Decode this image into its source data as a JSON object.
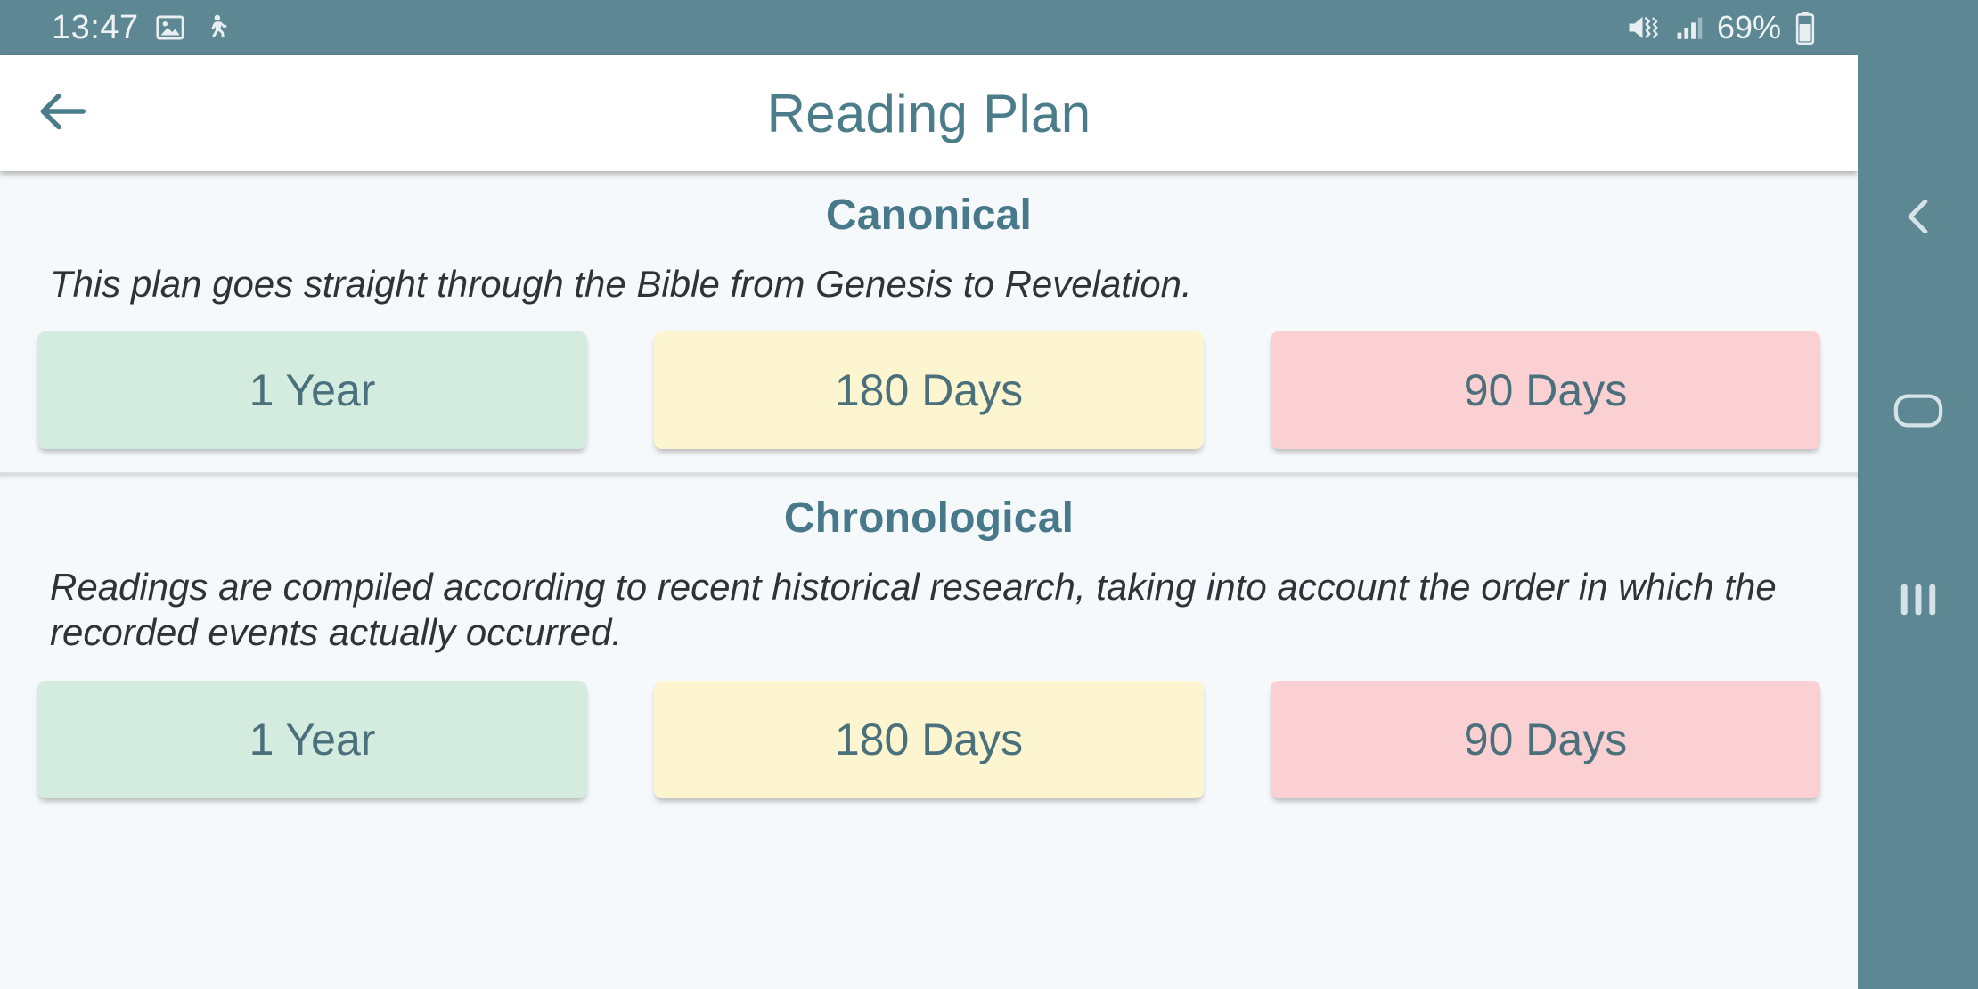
{
  "status_bar": {
    "clock": "13:47",
    "battery_percent": "69%",
    "icons": [
      "gallery-icon",
      "person-activity-icon",
      "volume-mute-vibrate-icon",
      "signal-bars-icon",
      "battery-icon"
    ]
  },
  "app_bar": {
    "back_label": "back-arrow-icon",
    "title": "Reading Plan"
  },
  "sections": [
    {
      "title": "Canonical",
      "description": "This plan goes straight through the Bible from Genesis to Revelation.",
      "buttons": [
        {
          "label": "1 Year",
          "color": "#d4ecdf"
        },
        {
          "label": "180 Days",
          "color": "#fcf5d0"
        },
        {
          "label": "90 Days",
          "color": "#fbd0d2"
        }
      ]
    },
    {
      "title": "Chronological",
      "description": "Readings are compiled according to recent historical research, taking into account the order in which the recorded events actually occurred.",
      "buttons": [
        {
          "label": "1 Year",
          "color": "#d4ecdf"
        },
        {
          "label": "180 Days",
          "color": "#fcf5d0"
        },
        {
          "label": "90 Days",
          "color": "#fbd0d2"
        }
      ]
    }
  ],
  "nav_bar": {
    "back": "chevron-left-icon",
    "home": "home-rounded-rect-icon",
    "recents": "recents-bars-icon"
  },
  "colors": {
    "accent_teal": "#4a7c8a",
    "system_bar": "#5d8792",
    "page_bg": "#f6f9fb",
    "app_bar_bg": "#ffffff",
    "body_text": "#2f3337"
  }
}
